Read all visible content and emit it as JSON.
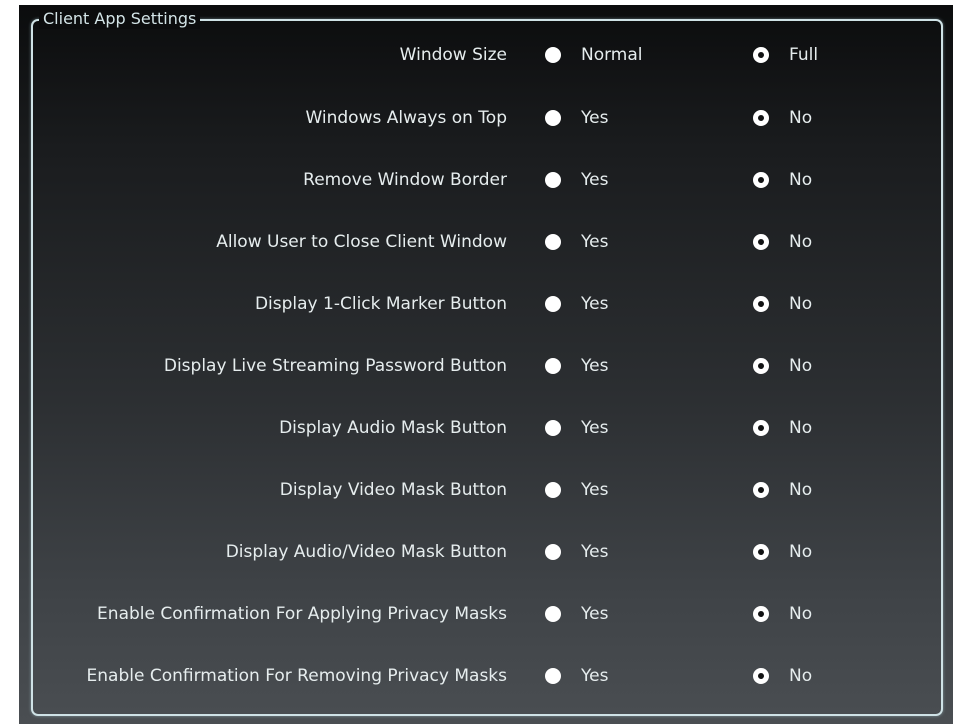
{
  "group": {
    "title": "Client App Settings"
  },
  "settings": [
    {
      "label": "Window Size",
      "option_a": "Normal",
      "option_b": "Full",
      "selected": "option_b"
    },
    {
      "label": "Windows Always on Top",
      "option_a": "Yes",
      "option_b": "No",
      "selected": "option_b"
    },
    {
      "label": "Remove Window Border",
      "option_a": "Yes",
      "option_b": "No",
      "selected": "option_b"
    },
    {
      "label": "Allow User to Close Client Window",
      "option_a": "Yes",
      "option_b": "No",
      "selected": "option_b"
    },
    {
      "label": "Display 1-Click Marker Button",
      "option_a": "Yes",
      "option_b": "No",
      "selected": "option_b"
    },
    {
      "label": "Display Live Streaming Password Button",
      "option_a": "Yes",
      "option_b": "No",
      "selected": "option_b"
    },
    {
      "label": "Display Audio Mask Button",
      "option_a": "Yes",
      "option_b": "No",
      "selected": "option_b"
    },
    {
      "label": "Display Video Mask Button",
      "option_a": "Yes",
      "option_b": "No",
      "selected": "option_b"
    },
    {
      "label": "Display Audio/Video Mask Button",
      "option_a": "Yes",
      "option_b": "No",
      "selected": "option_b"
    },
    {
      "label": "Enable Confirmation For Applying Privacy Masks",
      "option_a": "Yes",
      "option_b": "No",
      "selected": "option_b"
    },
    {
      "label": "Enable Confirmation For Removing Privacy Masks",
      "option_a": "Yes",
      "option_b": "No",
      "selected": "option_b"
    }
  ],
  "colors": {
    "frame": "#cfe2e6",
    "text": "#e6edee",
    "radio_fill": "#ffffff",
    "radio_dot": "#111213"
  }
}
